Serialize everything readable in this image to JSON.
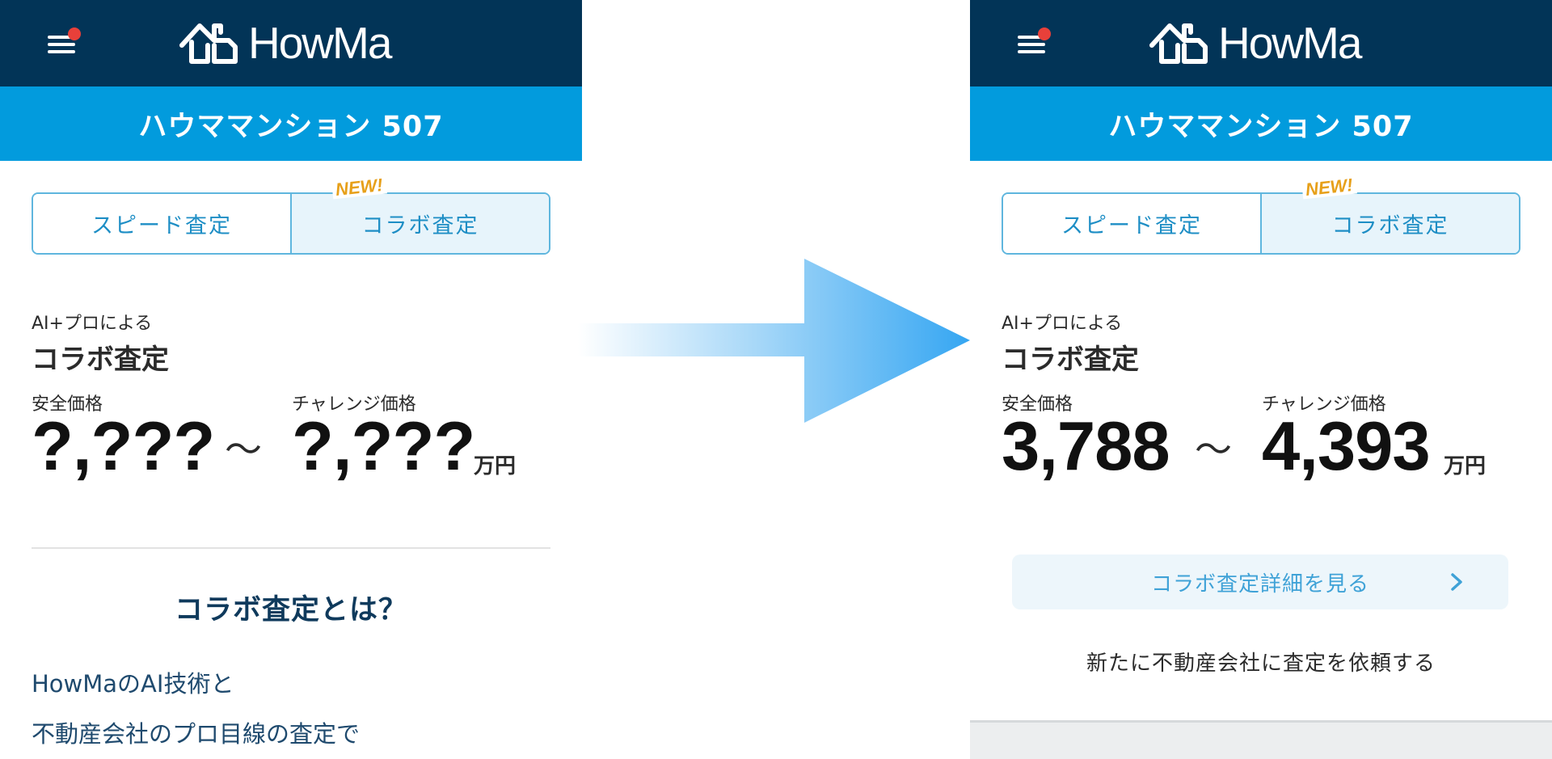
{
  "app": {
    "logo_text": "HowMa"
  },
  "property": {
    "name": "ハウママンション 507"
  },
  "tabs": {
    "speed_label": "スピード査定",
    "collab_label": "コラボ査定",
    "new_badge": "NEW!"
  },
  "appraisal": {
    "subtitle": "AI+プロによる",
    "title": "コラボ査定",
    "safe_label": "安全価格",
    "challenge_label": "チャレンジ価格",
    "tilde": "～",
    "unit": "万円"
  },
  "before": {
    "safe_value": "?,???",
    "challenge_value": "?,???"
  },
  "after": {
    "safe_value": "3,788",
    "challenge_value": "4,393"
  },
  "about": {
    "heading": "コラボ査定とは？",
    "lines": [
      "HowMaのAI技術と",
      "不動産会社のプロ目線の査定で"
    ]
  },
  "actions": {
    "detail_label": "コラボ査定詳細を見る",
    "request_label": "新たに不動産会社に査定を依頼する"
  },
  "colors": {
    "header_navy": "#023457",
    "subheader_blue": "#029bdd",
    "tab_blue": "#1e8ec5",
    "new_badge": "#e7a01a",
    "notification_dot": "#e8403a"
  },
  "icons": {
    "menu": "hamburger-menu-icon",
    "logo": "house-logo-icon",
    "transition": "right-arrow-icon",
    "chevron": "chevron-right-icon"
  }
}
